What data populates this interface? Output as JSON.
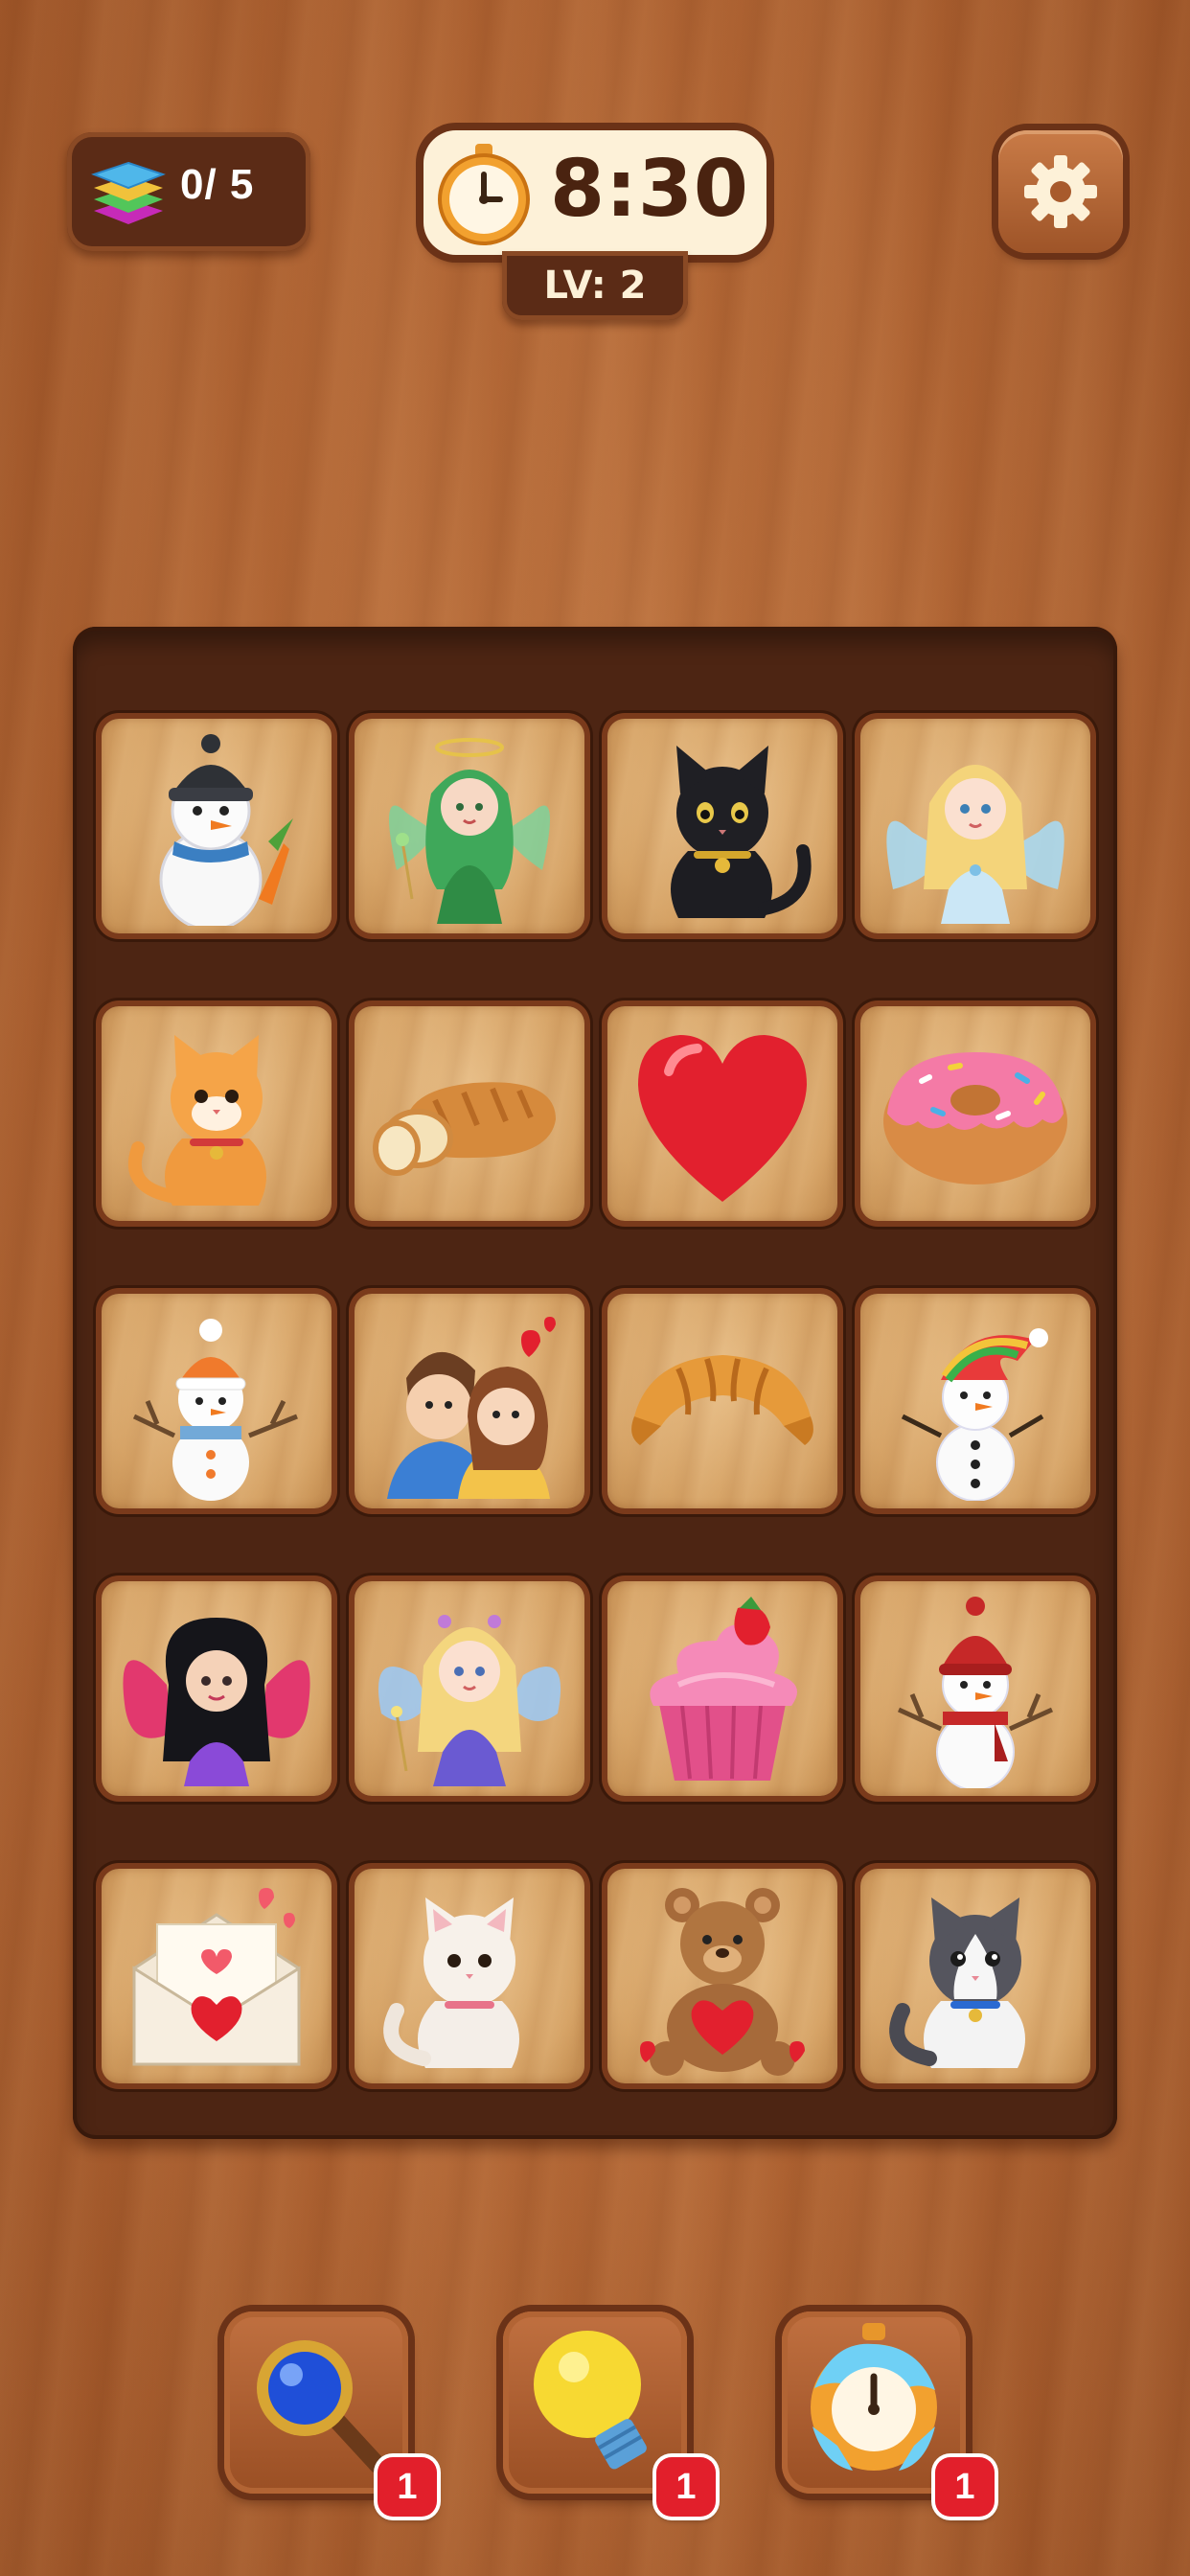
{
  "hud": {
    "layers_count": "0/ 5",
    "timer": "8:30",
    "level": "LV: 2",
    "layers_icon": "layers-stack-icon",
    "timer_icon": "stopwatch-icon",
    "settings_icon": "gear-icon"
  },
  "board": {
    "rows": 5,
    "columns": 4,
    "tiles": [
      {
        "name": "snowman-black-hat-carrot"
      },
      {
        "name": "green-fairy-angel"
      },
      {
        "name": "black-cat"
      },
      {
        "name": "blue-fairy-blonde"
      },
      {
        "name": "orange-cat"
      },
      {
        "name": "bread-loaf"
      },
      {
        "name": "red-heart"
      },
      {
        "name": "pink-donut"
      },
      {
        "name": "snowman-orange-hat"
      },
      {
        "name": "couple-hearts"
      },
      {
        "name": "croissant"
      },
      {
        "name": "snowman-rainbow-hat"
      },
      {
        "name": "butterfly-fairy-dark-hair"
      },
      {
        "name": "purple-fairy-blonde"
      },
      {
        "name": "cupcake-strawberry"
      },
      {
        "name": "snowman-red-hat-scarf"
      },
      {
        "name": "love-letter"
      },
      {
        "name": "white-cat"
      },
      {
        "name": "teddy-bear-heart"
      },
      {
        "name": "gray-white-cat"
      }
    ]
  },
  "tools": [
    {
      "name": "magnifier",
      "icon": "magnifying-glass-icon",
      "count": "1"
    },
    {
      "name": "hint",
      "icon": "lightbulb-icon",
      "count": "1"
    },
    {
      "name": "freeze",
      "icon": "frozen-clock-icon",
      "count": "1"
    }
  ],
  "colors": {
    "board": "#4d2513",
    "tile": "#dcae74",
    "badge": "#e21f2b",
    "timer_bg": "#fdf1d8"
  }
}
